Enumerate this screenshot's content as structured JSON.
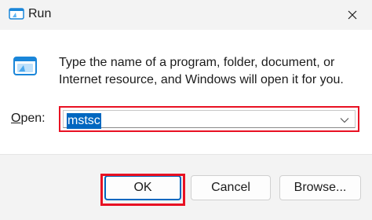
{
  "window": {
    "title": "Run",
    "title_icon": "run-app-icon",
    "close_icon": "close-icon"
  },
  "body": {
    "icon": "run-icon",
    "description": "Type the name of a program, folder, document, or Internet resource, and Windows will open it for you."
  },
  "open_field": {
    "label_prefix": "O",
    "label_rest": "pen:",
    "value": "mstsc",
    "dropdown_icon": "chevron-down-icon"
  },
  "buttons": {
    "ok": "OK",
    "cancel": "Cancel",
    "browse": "Browse..."
  },
  "colors": {
    "accent": "#0067c0",
    "highlight": "#e81123",
    "window_bg": "#f3f3f3",
    "content_bg": "#ffffff"
  }
}
